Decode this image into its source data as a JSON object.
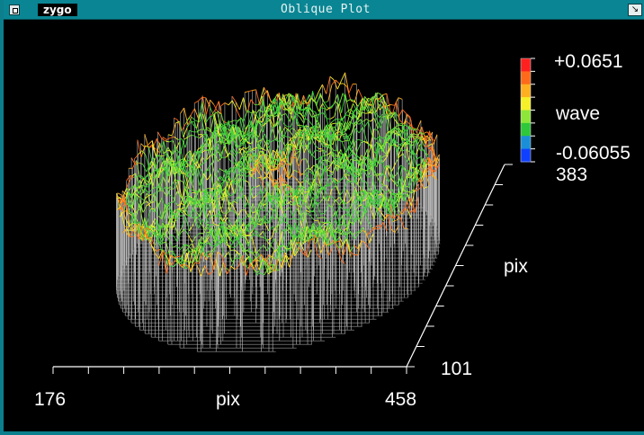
{
  "window": {
    "title": "Oblique Plot",
    "app_label": "zygo",
    "frame_color": "#0a8593"
  },
  "plot": {
    "type": "oblique-3d-surface",
    "x_axis": {
      "min": "176",
      "max": "458",
      "label": "pix"
    },
    "y_axis": {
      "min": "101",
      "max": "383",
      "label": "pix"
    },
    "colorbar": {
      "max_label": "+0.0651",
      "min_label": "-0.06055",
      "unit": "wave",
      "colors": [
        "#ff2020",
        "#ff6a1a",
        "#ffb020",
        "#f6f02a",
        "#8ee63a",
        "#2ec83a",
        "#1a8fd8",
        "#1040ff"
      ]
    }
  }
}
